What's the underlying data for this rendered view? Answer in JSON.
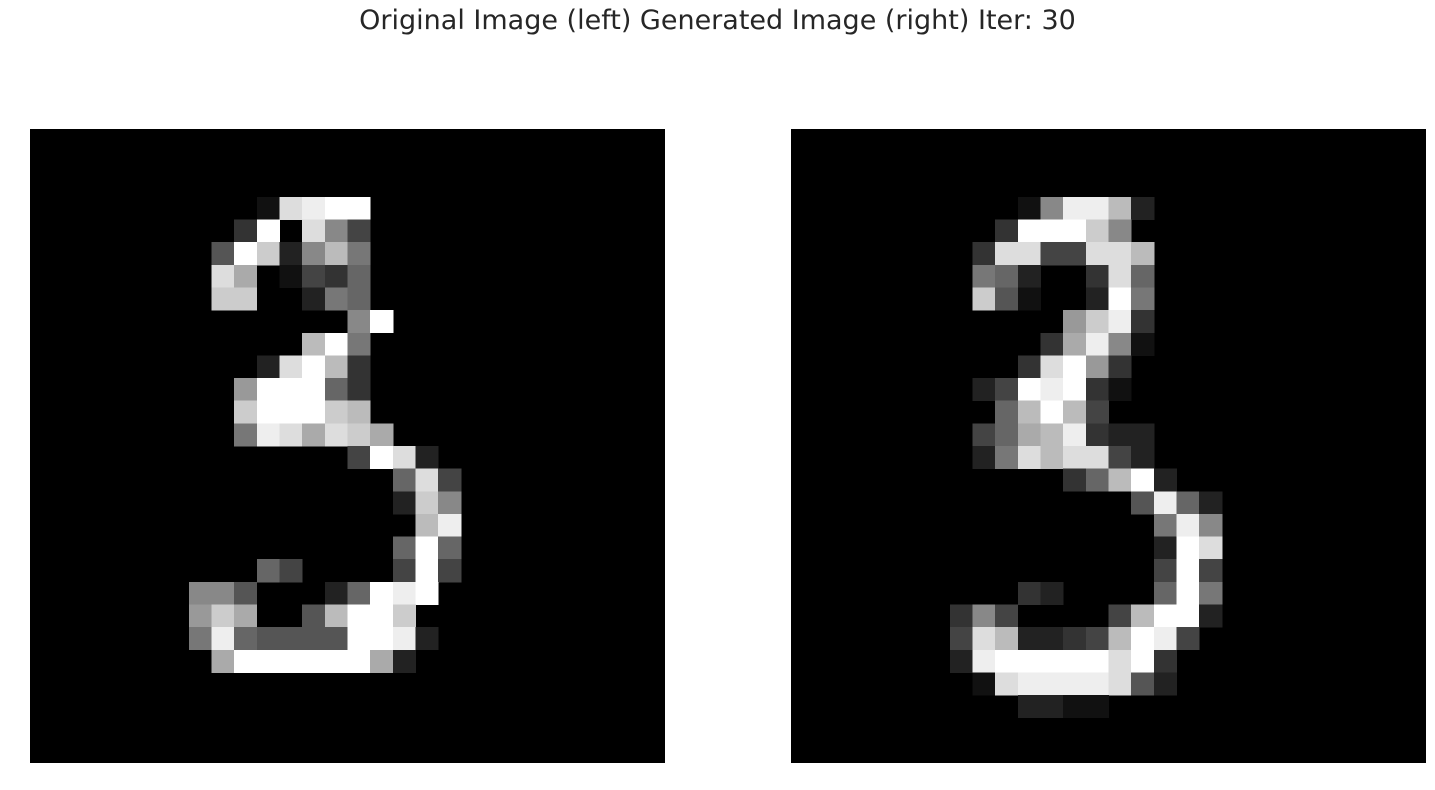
{
  "figure": {
    "title": "Original Image (left) Generated Image (right) Iter: 30"
  },
  "panels": [
    {
      "name": "original-image",
      "grid_size": 28,
      "pixels": [
        "............................",
        "............................",
        "............................",
        "..........amnop.............",
        ".........cp.mhd.............",
        "........eolbhkg.............",
        "........mj.adcf.............",
        "........ll..bgf.............",
        "..............hp............",
        "............kog.............",
        "..........bmpkc.............",
        ".........ipoofc.............",
        ".........lppplk.............",
        ".........gnmjmlj............",
        "..............dpmb..........",
        "................fmd.........",
        "................blh.........",
        ".................kn.........",
        "................fof.........",
        "..........fd....dpd.........",
        ".......hhe...bfpno..........",
        ".......ilj..ekopl...........",
        ".......gnfeeeeoonb..........",
        "........jppppppjb...........",
        "............................",
        "............................",
        "............................",
        "............................"
      ]
    },
    {
      "name": "generated-image",
      "grid_size": 28,
      "pixels": [
        "............................",
        "............................",
        "............................",
        "..........ahnnkb............",
        ".........cpoolh.............",
        "........cmmddmmk............",
        "........gfb..cmf............",
        "........lea..bog............",
        "............ilnc............",
        "...........cjnha............",
        "..........cmpic.............",
        "........bdonpca.............",
        ".........fkpkd..............",
        "........dfjkncbb............",
        "........bgmkmmdb............",
        "............cfkob...........",
        "...............enfb.........",
        "................gnh.........",
        "................bom.........",
        "................dod.........",
        "..........cb....fpg.........",
        ".......chd....dkopb.........",
        ".......dmkbbcdkpnd..........",
        ".......bnpppppmoc...........",
        "........amnnnnmeb...........",
        "..........bbaa..............",
        "............................",
        "............................"
      ]
    }
  ],
  "gray_levels": "0=. a=17 b=34 ... p=255 (linear steps of 17)"
}
